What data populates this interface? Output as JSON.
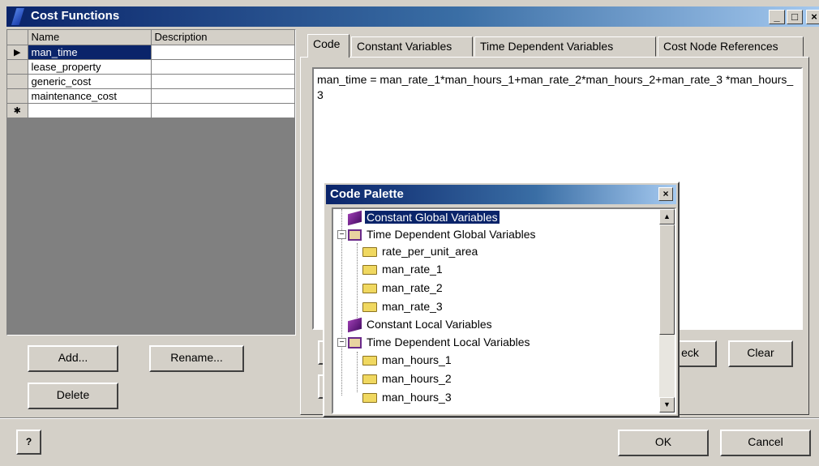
{
  "window": {
    "title": "Cost Functions",
    "min": "_",
    "max": "□",
    "close": "×"
  },
  "grid": {
    "headers": {
      "name": "Name",
      "description": "Description"
    },
    "rows": [
      {
        "marker": "▶",
        "name": "man_time",
        "description": ""
      },
      {
        "marker": "",
        "name": "lease_property",
        "description": ""
      },
      {
        "marker": "",
        "name": "generic_cost",
        "description": ""
      },
      {
        "marker": "",
        "name": "maintenance_cost",
        "description": ""
      },
      {
        "marker": "✱",
        "name": "",
        "description": ""
      }
    ]
  },
  "left_buttons": {
    "add": "Add...",
    "rename": "Rename...",
    "delete": "Delete"
  },
  "tabs": [
    "Code",
    "Constant Variables",
    "Time Dependent Variables",
    "Cost Node References"
  ],
  "code": "man_time = man_rate_1*man_hours_1+man_rate_2*man_hours_2+man_rate_3 *man_hours_3",
  "right_buttons": {
    "check": "eck",
    "clear": "Clear"
  },
  "palette": {
    "title": "Code Palette",
    "close": "×",
    "items": [
      {
        "label": "Constant Global Variables",
        "kind": "book"
      },
      {
        "label": "Time Dependent Global Variables",
        "kind": "openbook"
      },
      {
        "label": "rate_per_unit_area",
        "kind": "folder"
      },
      {
        "label": "man_rate_1",
        "kind": "folder"
      },
      {
        "label": "man_rate_2",
        "kind": "folder"
      },
      {
        "label": "man_rate_3",
        "kind": "folder"
      },
      {
        "label": "Constant Local Variables",
        "kind": "book"
      },
      {
        "label": "Time Dependent Local Variables",
        "kind": "openbook"
      },
      {
        "label": "man_hours_1",
        "kind": "folder"
      },
      {
        "label": "man_hours_2",
        "kind": "folder"
      },
      {
        "label": "man_hours_3",
        "kind": "folder"
      }
    ],
    "expander_minus": "−",
    "scroll_up": "▲",
    "scroll_down": "▼"
  },
  "footer": {
    "help": "?",
    "ok": "OK",
    "cancel": "Cancel"
  },
  "colors": {
    "selection": "#0a246a",
    "face": "#d4d0c8"
  }
}
